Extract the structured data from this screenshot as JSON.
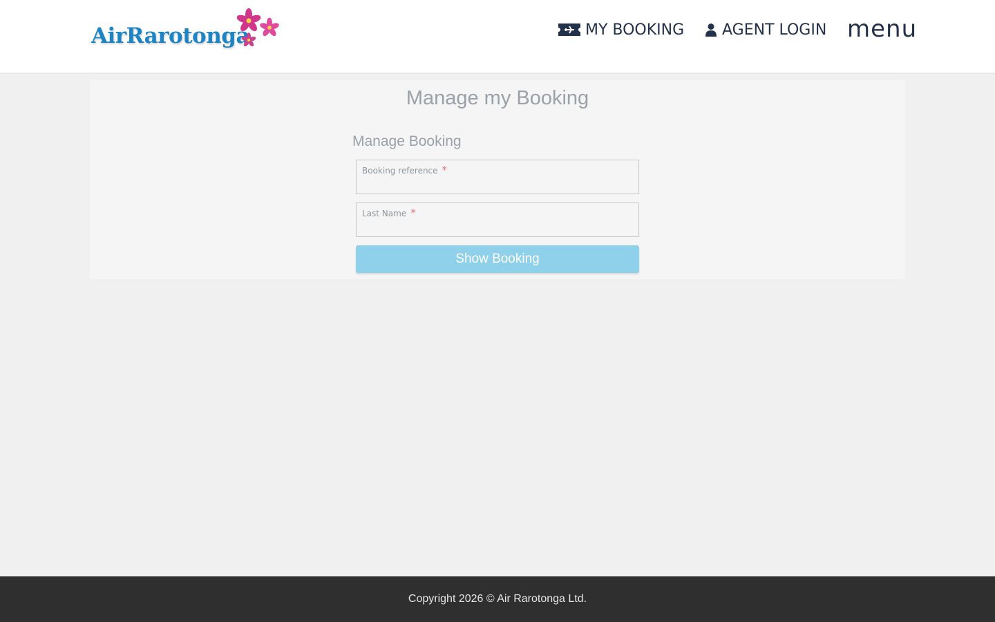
{
  "header": {
    "logo_text": "AirRarotonga",
    "nav": {
      "my_booking": {
        "label": "MY BOOKING",
        "icon": "ticket-icon"
      },
      "agent_login": {
        "label": "AGENT LOGIN",
        "icon": "user-icon"
      },
      "menu_label": "menu"
    }
  },
  "main": {
    "page_title": "Manage my Booking",
    "section_title": "Manage Booking",
    "fields": {
      "booking_reference": {
        "label": "Booking reference",
        "required_mark": "*",
        "value": ""
      },
      "last_name": {
        "label": "Last Name",
        "required_mark": "*",
        "value": ""
      }
    },
    "submit_label": "Show Booking"
  },
  "footer": {
    "copyright": "Copyright 2026 © Air Rarotonga Ltd."
  },
  "colors": {
    "nav_text": "#24314a",
    "brand_blue": "#1f84c4",
    "flower_pink": "#d0368a",
    "button": "#8fd0ea",
    "footer_bg": "#2f2f2f"
  }
}
